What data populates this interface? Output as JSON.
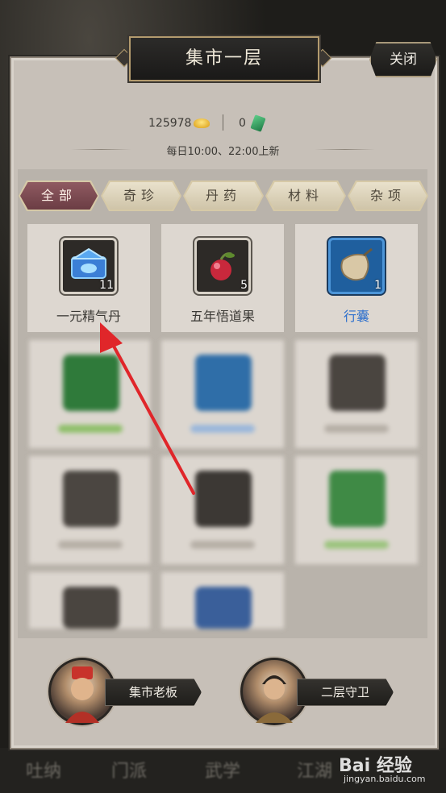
{
  "window": {
    "title": "集市一层",
    "close_label": "关闭"
  },
  "currency": {
    "gold": "125978",
    "jade": "0"
  },
  "schedule_text": "每日10:00、22:00上新",
  "tabs": [
    {
      "label": "全部",
      "active": true
    },
    {
      "label": "奇珍",
      "active": false
    },
    {
      "label": "丹药",
      "active": false
    },
    {
      "label": "材料",
      "active": false
    },
    {
      "label": "杂项",
      "active": false
    }
  ],
  "items": [
    {
      "name": "一元精气丹",
      "count": "11",
      "quality": "gray",
      "icon": "blue-chest-icon"
    },
    {
      "name": "五年悟道果",
      "count": "5",
      "quality": "gray",
      "icon": "red-fruit-icon"
    },
    {
      "name": "行囊",
      "count": "1",
      "quality": "blue",
      "icon": "bag-icon"
    }
  ],
  "npcs": [
    {
      "label": "集市老板"
    },
    {
      "label": "二层守卫"
    }
  ],
  "bottom_nav": [
    "吐纳",
    "门派",
    "武学",
    "江湖"
  ],
  "watermark": {
    "brand": "Bai 经验",
    "url": "jingyan.baidu.com"
  },
  "colors": {
    "panel": "#c7c0b8",
    "active_tab": "#7d4a52",
    "blue_quality": "#2c6fcd",
    "arrow": "#e0262a"
  }
}
